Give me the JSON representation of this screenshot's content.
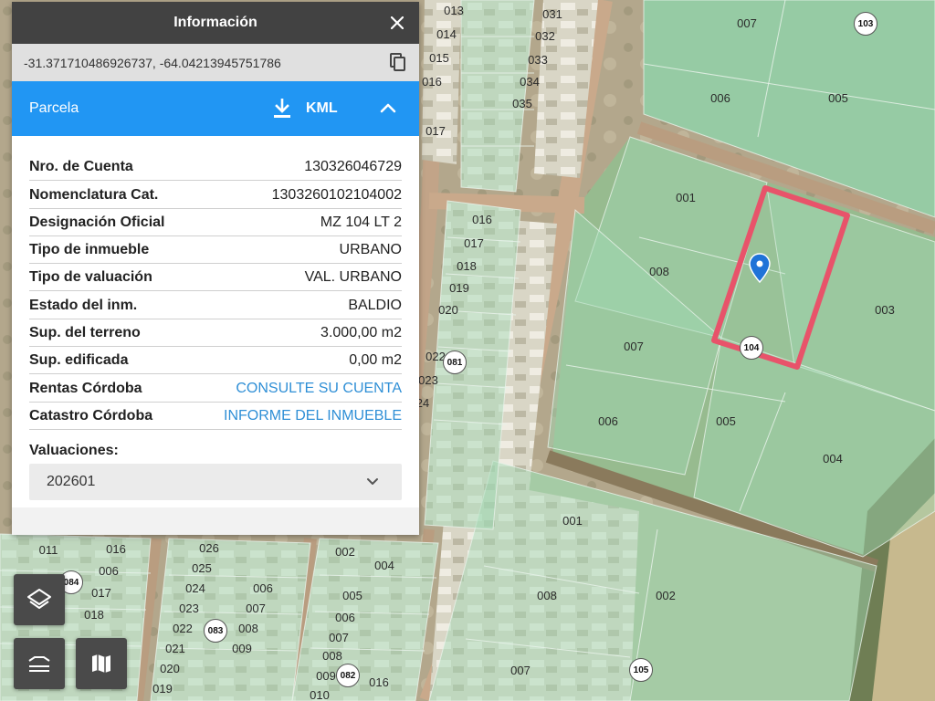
{
  "panel": {
    "title": "Información",
    "coordinates": "-31.371710486926737, -64.04213945751786",
    "section_title": "Parcela",
    "kml_label": "KML",
    "rows": [
      {
        "key": "Nro. de Cuenta",
        "value": "130326046729"
      },
      {
        "key": "Nomenclatura Cat.",
        "value": "1303260102104002"
      },
      {
        "key": "Designación Oficial",
        "value": "MZ 104 LT 2"
      },
      {
        "key": "Tipo de inmueble",
        "value": "URBANO"
      },
      {
        "key": "Tipo de valuación",
        "value": "VAL. URBANO"
      },
      {
        "key": "Estado del inm.",
        "value": "BALDIO"
      },
      {
        "key": "Sup. del terreno",
        "value": "3.000,00 m2"
      },
      {
        "key": "Sup. edificada",
        "value": "0,00 m2"
      },
      {
        "key": "Rentas Córdoba",
        "value": "CONSULTE SU CUENTA"
      },
      {
        "key": "Catastro Córdoba",
        "value": "INFORME DEL INMUEBLE"
      }
    ],
    "valuaciones_label": "Valuaciones:",
    "valuaciones_selected": "202601"
  },
  "colors": {
    "header": "#424242",
    "accent": "#2196f3",
    "link": "#2f8fd6",
    "selected_parcel_outline": "#e8536a",
    "parcel_fill": "#9fd9b4"
  },
  "map": {
    "block_badges": [
      "103",
      "081",
      "084",
      "083",
      "082",
      "105",
      "104"
    ],
    "lot_labels": [
      "013",
      "014",
      "015",
      "016",
      "017",
      "031",
      "032",
      "033",
      "034",
      "035",
      "007",
      "006",
      "005",
      "001",
      "008",
      "003",
      "007",
      "006",
      "005",
      "004",
      "016",
      "017",
      "018",
      "019",
      "020",
      "022",
      "023",
      "24",
      "001",
      "008",
      "002",
      "007",
      "011",
      "016",
      "006",
      "017",
      "018",
      "024",
      "026",
      "025",
      "024",
      "023",
      "022",
      "021",
      "020",
      "019",
      "006",
      "007",
      "008",
      "009",
      "002",
      "004",
      "005",
      "006",
      "007",
      "008",
      "009",
      "010",
      "016"
    ]
  },
  "icons": {
    "close": "close-icon",
    "copy": "copy-icon",
    "download": "download-icon",
    "collapse": "chevron-up-icon",
    "select": "chevron-down-icon",
    "layers": "layers-icon",
    "legend": "layers-stack-icon",
    "basemap": "map-icon",
    "marker": "map-pin-icon"
  }
}
